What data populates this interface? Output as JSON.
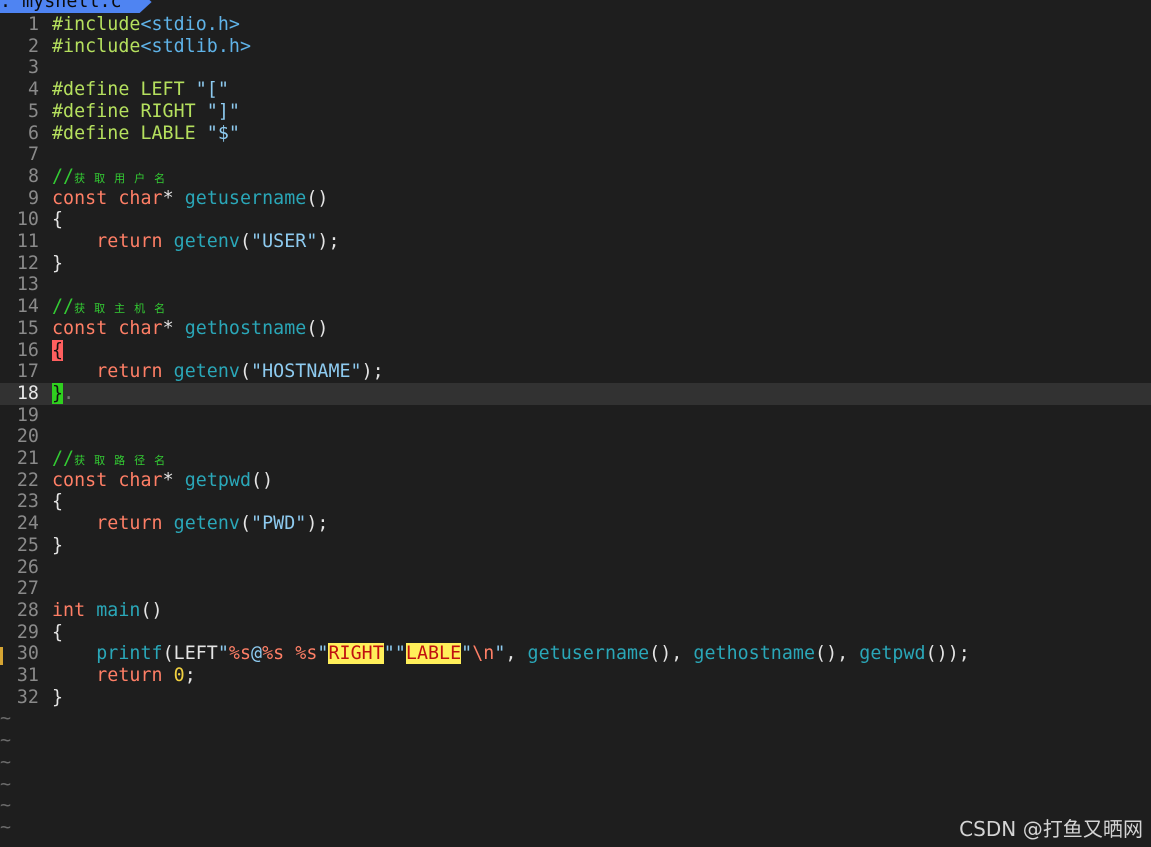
{
  "tab": {
    "label": ": myshell.c"
  },
  "lines": [
    {
      "n": "1",
      "tokens": [
        {
          "t": "#include",
          "c": "pre"
        },
        {
          "t": "<stdio.h>",
          "c": "hdr"
        }
      ]
    },
    {
      "n": "2",
      "tokens": [
        {
          "t": "#include",
          "c": "pre"
        },
        {
          "t": "<stdlib.h>",
          "c": "hdr"
        }
      ]
    },
    {
      "n": "3",
      "tokens": []
    },
    {
      "n": "4",
      "tokens": [
        {
          "t": "#define LEFT ",
          "c": "pre"
        },
        {
          "t": "\"[\"",
          "c": "str"
        }
      ]
    },
    {
      "n": "5",
      "tokens": [
        {
          "t": "#define RIGHT ",
          "c": "pre"
        },
        {
          "t": "\"]\"",
          "c": "str"
        }
      ]
    },
    {
      "n": "6",
      "tokens": [
        {
          "t": "#define LABLE ",
          "c": "pre"
        },
        {
          "t": "\"$\"",
          "c": "str"
        }
      ]
    },
    {
      "n": "7",
      "tokens": []
    },
    {
      "n": "8",
      "tokens": [
        {
          "t": "//",
          "c": "cmt"
        },
        {
          "t": "获取用户名",
          "c": "cjk"
        }
      ]
    },
    {
      "n": "9",
      "tokens": [
        {
          "t": "const ",
          "c": "kw"
        },
        {
          "t": "char",
          "c": "ty"
        },
        {
          "t": "* ",
          "c": "punc"
        },
        {
          "t": "getusername",
          "c": "fn"
        },
        {
          "t": "()",
          "c": "punc"
        }
      ]
    },
    {
      "n": "10",
      "tokens": [
        {
          "t": "{",
          "c": "punc"
        }
      ]
    },
    {
      "n": "11",
      "tokens": [
        {
          "t": "    ",
          "c": "punc"
        },
        {
          "t": "return ",
          "c": "kw"
        },
        {
          "t": "getenv",
          "c": "fn"
        },
        {
          "t": "(",
          "c": "punc"
        },
        {
          "t": "\"USER\"",
          "c": "str"
        },
        {
          "t": ");",
          "c": "punc"
        }
      ]
    },
    {
      "n": "12",
      "tokens": [
        {
          "t": "}",
          "c": "punc"
        }
      ]
    },
    {
      "n": "13",
      "tokens": []
    },
    {
      "n": "14",
      "tokens": [
        {
          "t": "//",
          "c": "cmt"
        },
        {
          "t": "获取主机名",
          "c": "cjk"
        }
      ]
    },
    {
      "n": "15",
      "tokens": [
        {
          "t": "const ",
          "c": "kw"
        },
        {
          "t": "char",
          "c": "ty"
        },
        {
          "t": "* ",
          "c": "punc"
        },
        {
          "t": "gethostname",
          "c": "fn"
        },
        {
          "t": "()",
          "c": "punc"
        }
      ]
    },
    {
      "n": "16",
      "tokens": [
        {
          "t": "{",
          "c": "mbrace"
        }
      ]
    },
    {
      "n": "17",
      "tokens": [
        {
          "t": "    ",
          "c": "punc"
        },
        {
          "t": "return ",
          "c": "kw"
        },
        {
          "t": "getenv",
          "c": "fn"
        },
        {
          "t": "(",
          "c": "punc"
        },
        {
          "t": "\"HOSTNAME\"",
          "c": "str"
        },
        {
          "t": ");",
          "c": "punc"
        }
      ]
    },
    {
      "n": "18",
      "current": true,
      "tokens": [
        {
          "t": "}",
          "c": "cbrace"
        },
        {
          "t": ".",
          "c": "dot"
        }
      ]
    },
    {
      "n": "19",
      "tokens": []
    },
    {
      "n": "20",
      "tokens": []
    },
    {
      "n": "21",
      "tokens": [
        {
          "t": "//",
          "c": "cmt"
        },
        {
          "t": "获取路径名",
          "c": "cjk"
        }
      ]
    },
    {
      "n": "22",
      "tokens": [
        {
          "t": "const ",
          "c": "kw"
        },
        {
          "t": "char",
          "c": "ty"
        },
        {
          "t": "* ",
          "c": "punc"
        },
        {
          "t": "getpwd",
          "c": "fn"
        },
        {
          "t": "()",
          "c": "punc"
        }
      ]
    },
    {
      "n": "23",
      "tokens": [
        {
          "t": "{",
          "c": "punc"
        }
      ]
    },
    {
      "n": "24",
      "tokens": [
        {
          "t": "    ",
          "c": "punc"
        },
        {
          "t": "return ",
          "c": "kw"
        },
        {
          "t": "getenv",
          "c": "fn"
        },
        {
          "t": "(",
          "c": "punc"
        },
        {
          "t": "\"PWD\"",
          "c": "str"
        },
        {
          "t": ");",
          "c": "punc"
        }
      ]
    },
    {
      "n": "25",
      "tokens": [
        {
          "t": "}",
          "c": "punc"
        }
      ]
    },
    {
      "n": "26",
      "tokens": []
    },
    {
      "n": "27",
      "tokens": []
    },
    {
      "n": "28",
      "tokens": [
        {
          "t": "int ",
          "c": "ty"
        },
        {
          "t": "main",
          "c": "fn"
        },
        {
          "t": "()",
          "c": "punc"
        }
      ]
    },
    {
      "n": "29",
      "tokens": [
        {
          "t": "{",
          "c": "punc"
        }
      ]
    },
    {
      "n": "30",
      "sign": true,
      "tokens": [
        {
          "t": "    ",
          "c": "punc"
        },
        {
          "t": "printf",
          "c": "fn"
        },
        {
          "t": "(LEFT",
          "c": "punc"
        },
        {
          "t": "\"",
          "c": "str"
        },
        {
          "t": "%s",
          "c": "fmt"
        },
        {
          "t": "@",
          "c": "str"
        },
        {
          "t": "%s",
          "c": "fmt"
        },
        {
          "t": " ",
          "c": "str"
        },
        {
          "t": "%s",
          "c": "fmt"
        },
        {
          "t": "\"",
          "c": "str"
        },
        {
          "t": "RIGHT",
          "c": "hl"
        },
        {
          "t": "\"\"",
          "c": "str"
        },
        {
          "t": "LABLE",
          "c": "hl"
        },
        {
          "t": "\"",
          "c": "str"
        },
        {
          "t": "\\n",
          "c": "esc"
        },
        {
          "t": "\"",
          "c": "str"
        },
        {
          "t": ", ",
          "c": "punc"
        },
        {
          "t": "getusername",
          "c": "fn"
        },
        {
          "t": "(), ",
          "c": "punc"
        },
        {
          "t": "gethostname",
          "c": "fn"
        },
        {
          "t": "(), ",
          "c": "punc"
        },
        {
          "t": "getpwd",
          "c": "fn"
        },
        {
          "t": "());",
          "c": "punc"
        }
      ]
    },
    {
      "n": "31",
      "tokens": [
        {
          "t": "    ",
          "c": "punc"
        },
        {
          "t": "return ",
          "c": "kw"
        },
        {
          "t": "0",
          "c": "num"
        },
        {
          "t": ";",
          "c": "punc"
        }
      ]
    },
    {
      "n": "32",
      "tokens": [
        {
          "t": "}",
          "c": "punc"
        }
      ]
    }
  ],
  "tildes": [
    "~",
    "~",
    "~",
    "~",
    "~",
    "~"
  ],
  "watermark": "CSDN @打鱼又晒网"
}
